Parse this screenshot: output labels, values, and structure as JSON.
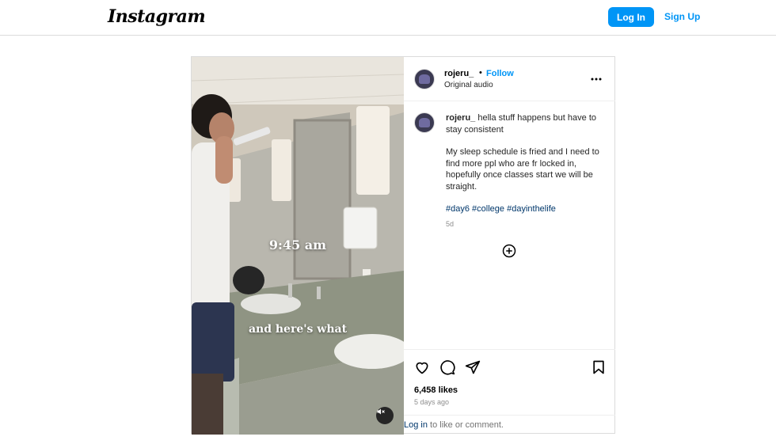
{
  "header": {
    "logo_text": "Instagram",
    "login_label": "Log In",
    "signup_label": "Sign Up"
  },
  "post": {
    "username": "rojeru_",
    "separator": "•",
    "follow_label": "Follow",
    "audio_label": "Original audio",
    "more_icon": "more-horizontal-icon",
    "caption": {
      "username": "rojeru_",
      "line1": " hella stuff happens but have to stay consistent",
      "line2": "My sleep schedule is fried and I need to find more ppl who are fr locked in, hopefully once classes start we will be straight.",
      "hashtags": [
        "#day6",
        "#college",
        "#dayinthelife"
      ],
      "age": "5d"
    },
    "video_overlay": {
      "line1": "9:45 am",
      "line2": "and here's what"
    },
    "likes": "6,458 likes",
    "posted_ago": "5 days ago",
    "login_prompt": {
      "link": "Log in",
      "rest": " to like or comment."
    }
  },
  "colors": {
    "accent": "#0095f6",
    "hashtag": "#00376b",
    "border": "#dbdbdb",
    "muted_text": "#8e8e8e"
  }
}
